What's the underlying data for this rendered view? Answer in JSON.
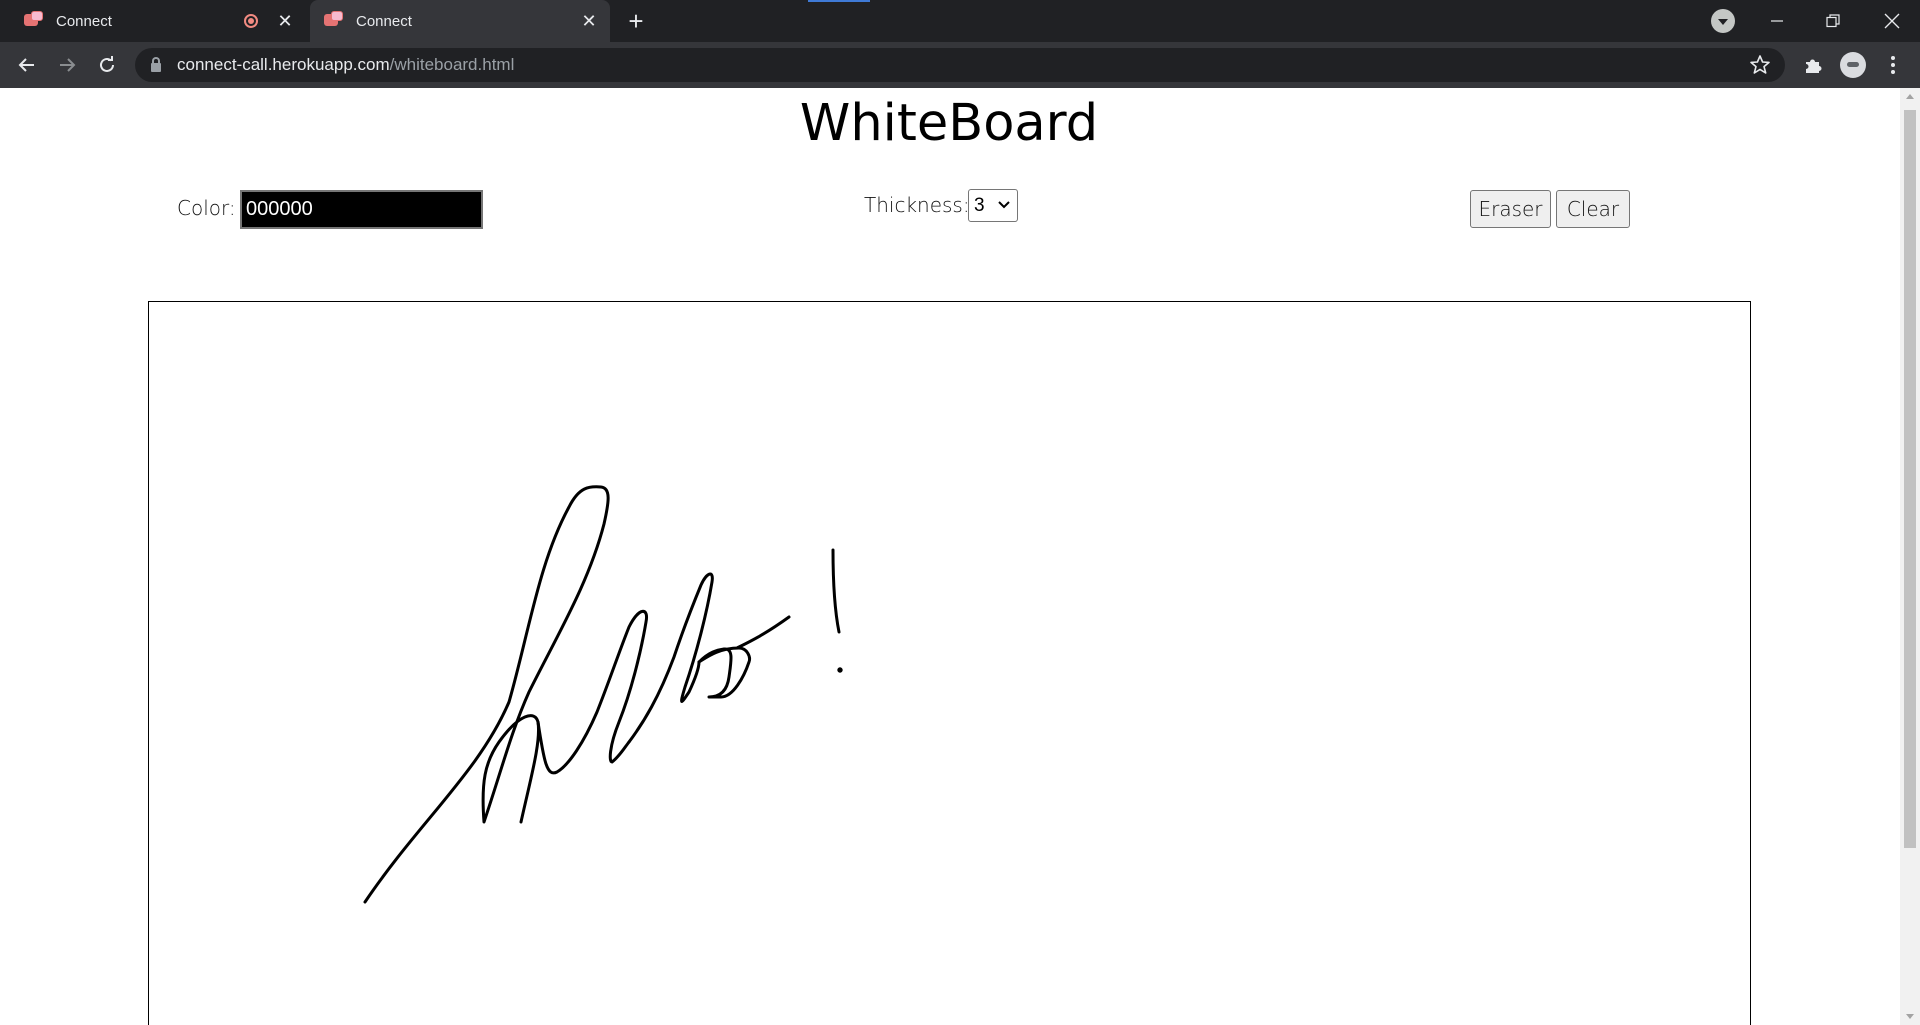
{
  "browser": {
    "tabs": [
      {
        "title": "Connect",
        "recording": true
      },
      {
        "title": "Connect",
        "active": true
      }
    ],
    "url": {
      "host": "connect-call.herokuapp.com",
      "path": "/whiteboard.html"
    }
  },
  "page": {
    "title": "WhiteBoard",
    "color": {
      "label": "Color:",
      "value": "000000"
    },
    "thickness": {
      "label": "Thickness:",
      "selected": "3"
    },
    "eraser_label": "Eraser",
    "clear_label": "Clear",
    "drawing": {
      "text": "hello!",
      "stroke_color": "#000000"
    }
  }
}
